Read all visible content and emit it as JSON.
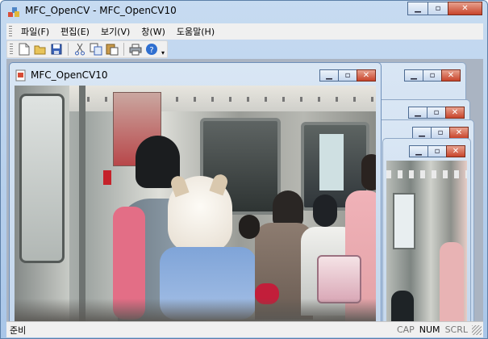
{
  "app": {
    "title": "MFC_OpenCV - MFC_OpenCV10"
  },
  "menu": [
    "파일(F)",
    "편집(E)",
    "보기(V)",
    "창(W)",
    "도움말(H)"
  ],
  "toolbar": {
    "buttons": [
      "new-icon",
      "open-folder-icon",
      "save-icon",
      "cut-icon",
      "copy-icon",
      "paste-icon",
      "print-icon",
      "help-icon"
    ]
  },
  "child_window": {
    "title": "MFC_OpenCV10"
  },
  "status": {
    "text": "준비",
    "indicators": {
      "cap": "CAP",
      "num": "NUM",
      "scrl": "SCRL"
    }
  },
  "colors": {
    "title_gradient_top": "#c7dbf1",
    "close_button": "#c8442b",
    "mdi_background": "#aab4c2"
  }
}
